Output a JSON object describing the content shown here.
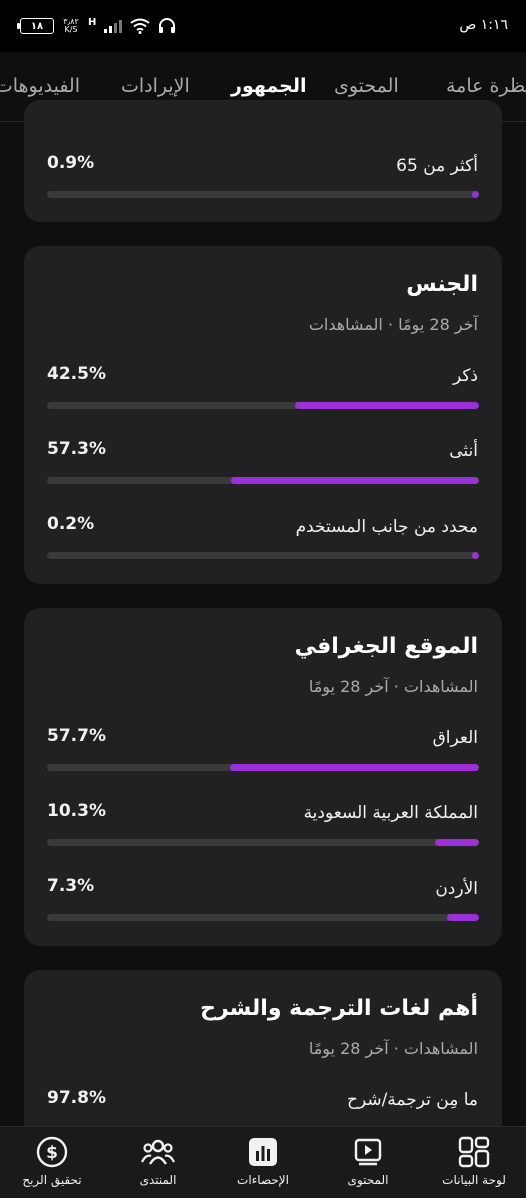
{
  "status_bar": {
    "time": "١:١٦ ص",
    "battery": "١٨",
    "net_speed_value": "٣٫٨٢",
    "net_speed_unit": "K/S",
    "signal_type": "H"
  },
  "tabs": [
    {
      "label": "نظرة عامة"
    },
    {
      "label": "المحتوى"
    },
    {
      "label": "الجمهور"
    },
    {
      "label": "الإيرادات"
    },
    {
      "label": "الفيديوهات"
    }
  ],
  "active_tab": "الجمهور",
  "age_card": {
    "rows": [
      {
        "label": "أكثر من 65",
        "percent": "0.9%",
        "value": 0.9
      }
    ]
  },
  "gender_card": {
    "title": "الجنس",
    "subtitle": "آخر 28 يومًا · المشاهدات",
    "rows": [
      {
        "label": "ذكر",
        "percent": "42.5%",
        "value": 42.5
      },
      {
        "label": "أنثى",
        "percent": "57.3%",
        "value": 57.3
      },
      {
        "label": "محدد من جانب المستخدم",
        "percent": "0.2%",
        "value": 0.2
      }
    ]
  },
  "geo_card": {
    "title": "الموقع الجغرافي",
    "subtitle": "المشاهدات · آخر 28 يومًا",
    "rows": [
      {
        "label": "العراق",
        "percent": "57.7%",
        "value": 57.7
      },
      {
        "label": "المملكة العربية السعودية",
        "percent": "10.3%",
        "value": 10.3
      },
      {
        "label": "الأردن",
        "percent": "7.3%",
        "value": 7.3
      }
    ]
  },
  "lang_card": {
    "title": "أهم لغات الترجمة والشرح",
    "subtitle": "المشاهدات · آخر 28 يومًا",
    "rows": [
      {
        "label": "ما مِن ترجمة/شرح",
        "percent": "97.8%",
        "value": 97.8
      }
    ]
  },
  "bottom_nav": [
    {
      "label": "لوحة البيانات",
      "icon": "dashboard-icon"
    },
    {
      "label": "المحتوى",
      "icon": "content-icon"
    },
    {
      "label": "الإحصاءات",
      "icon": "analytics-icon"
    },
    {
      "label": "المنتدى",
      "icon": "community-icon"
    },
    {
      "label": "تحقيق الربح",
      "icon": "earn-icon"
    }
  ],
  "colors": {
    "accent": "#9b30d9",
    "card_bg": "#212121",
    "page_bg": "#0f0f0f"
  }
}
